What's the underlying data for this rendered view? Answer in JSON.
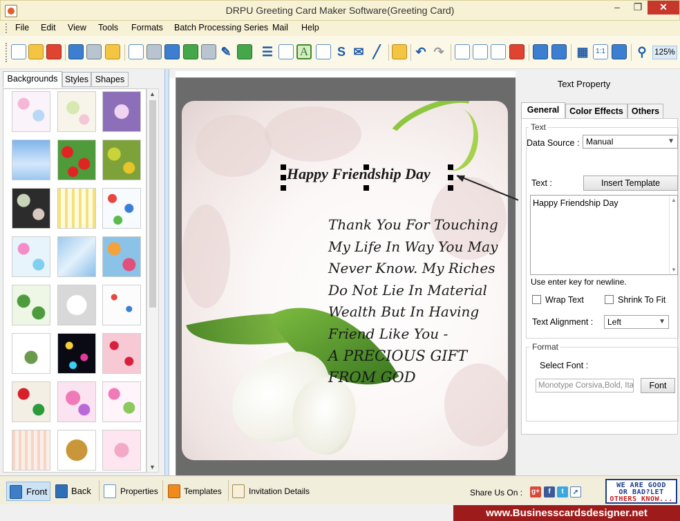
{
  "window": {
    "title": "DRPU Greeting Card Maker Software(Greeting Card)"
  },
  "menu": [
    "File",
    "Edit",
    "View",
    "Tools",
    "Formats",
    "Batch Processing Series",
    "Mail",
    "Help"
  ],
  "toolbar": {
    "zoom": "125%"
  },
  "left_panel": {
    "tabs": [
      "Backgrounds",
      "Styles",
      "Shapes"
    ],
    "active_tab": "Backgrounds"
  },
  "card": {
    "title": "Happy Friendship Day",
    "message": "Thank You For Touching\nMy Life In Way You May\nNever Know. My Riches\nDo Not Lie In Material\nWealth But In Having\nFriend Like You -",
    "message_caps": "A PRECIOUS GIFT\nFROM GOD"
  },
  "text_property": {
    "title": "Text Property",
    "tabs": [
      "General",
      "Color Effects",
      "Others"
    ],
    "active_tab": "General",
    "group_text": "Text",
    "data_source_label": "Data Source :",
    "data_source_value": "Manual",
    "text_label": "Text :",
    "insert_template": "Insert Template",
    "text_value": "Happy Friendship Day",
    "newline_hint": "Use enter key for newline.",
    "wrap_text": "Wrap Text",
    "shrink_to_fit": "Shrink To Fit",
    "alignment_label": "Text Alignment :",
    "alignment_value": "Left",
    "group_format": "Format",
    "select_font_label": "Select Font :",
    "font_value": "Monotype Corsiva,Bold, Italic",
    "font_button": "Font"
  },
  "bottom_bar": {
    "front": "Front",
    "back": "Back",
    "properties": "Properties",
    "templates": "Templates",
    "invitation_details": "Invitation Details",
    "share": "Share Us On :"
  },
  "feedback": {
    "line1": "WE ARE GOOD",
    "line2": "OR BAD?LET",
    "line3": "OTHERS KNOW..."
  },
  "site": "www.Businesscardsdesigner.net"
}
